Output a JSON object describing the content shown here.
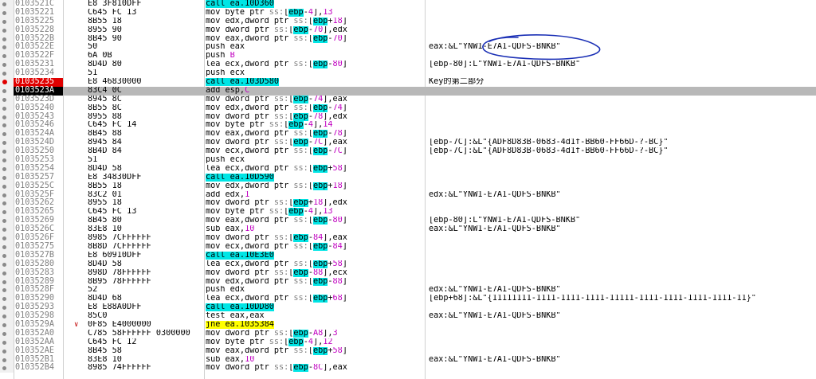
{
  "colors": {
    "breakpoint": "#e00000",
    "current": "#000000",
    "call_highlight": "#00e5e5",
    "jump_highlight": "#ffff00",
    "annotation_ink": "#1a2fb5"
  },
  "rows": [
    {
      "addr": "0103521C",
      "bytes": "E8 3F810DFF",
      "instr": "call ea.10D360",
      "kind": "call",
      "comment": ""
    },
    {
      "addr": "01035221",
      "bytes": "C645 FC 13",
      "instr": "mov byte ptr ss:[ebp-4],13",
      "comment": ""
    },
    {
      "addr": "01035225",
      "bytes": "8B55 18",
      "instr": "mov edx,dword ptr ss:[ebp+18]",
      "comment": ""
    },
    {
      "addr": "01035228",
      "bytes": "8955 90",
      "instr": "mov dword ptr ss:[ebp-70],edx",
      "comment": ""
    },
    {
      "addr": "0103522B",
      "bytes": "8B45 90",
      "instr": "mov eax,dword ptr ss:[ebp-70]",
      "comment": ""
    },
    {
      "addr": "0103522E",
      "bytes": "50",
      "instr": "push eax",
      "comment": "eax:&L\"YNW1-E7A1-QDFS-BNKB\""
    },
    {
      "addr": "0103522F",
      "bytes": "6A 0B",
      "instr": "push B",
      "comment": ""
    },
    {
      "addr": "01035231",
      "bytes": "8D4D 80",
      "instr": "lea ecx,dword ptr ss:[ebp-80]",
      "comment": "[ebp-80]:L\"YNW1-E7A1-QDFS-BNKB\""
    },
    {
      "addr": "01035234",
      "bytes": "51",
      "instr": "push ecx",
      "comment": ""
    },
    {
      "addr": "01035235",
      "bytes": "E8 46830000",
      "instr": "call ea.103D580",
      "kind": "call",
      "bp": true,
      "comment": "Key的第二部分"
    },
    {
      "addr": "0103523A",
      "bytes": "83C4 0C",
      "instr": "add esp,C",
      "cur": true,
      "comment": ""
    },
    {
      "addr": "0103523D",
      "bytes": "8945 8C",
      "instr": "mov dword ptr ss:[ebp-74],eax",
      "comment": ""
    },
    {
      "addr": "01035240",
      "bytes": "8B55 8C",
      "instr": "mov edx,dword ptr ss:[ebp-74]",
      "comment": ""
    },
    {
      "addr": "01035243",
      "bytes": "8955 88",
      "instr": "mov dword ptr ss:[ebp-78],edx",
      "comment": ""
    },
    {
      "addr": "01035246",
      "bytes": "C645 FC 14",
      "instr": "mov byte ptr ss:[ebp-4],14",
      "comment": ""
    },
    {
      "addr": "0103524A",
      "bytes": "8B45 88",
      "instr": "mov eax,dword ptr ss:[ebp-78]",
      "comment": ""
    },
    {
      "addr": "0103524D",
      "bytes": "8945 84",
      "instr": "mov dword ptr ss:[ebp-7C],eax",
      "comment": "[ebp-7C]:&L\"{ADF8D83B-0683-4d1f-BB60-FF66D-?-BC}\""
    },
    {
      "addr": "01035250",
      "bytes": "8B4D 84",
      "instr": "mov ecx,dword ptr ss:[ebp-7C]",
      "comment": "[ebp-7C]:&L\"{ADF8D83B-0683-4d1f-BB60-FF66D-?-BC}\""
    },
    {
      "addr": "01035253",
      "bytes": "51",
      "instr": "push ecx",
      "comment": ""
    },
    {
      "addr": "01035254",
      "bytes": "8D4D 58",
      "instr": "lea ecx,dword ptr ss:[ebp+58]",
      "comment": ""
    },
    {
      "addr": "01035257",
      "bytes": "E8 34830DFF",
      "instr": "call ea.10D590",
      "kind": "call",
      "comment": ""
    },
    {
      "addr": "0103525C",
      "bytes": "8B55 18",
      "instr": "mov edx,dword ptr ss:[ebp+18]",
      "comment": ""
    },
    {
      "addr": "0103525F",
      "bytes": "83C2 01",
      "instr": "add edx,1",
      "comment": "edx:&L\"YNW1-E7A1-QDFS-BNKB\""
    },
    {
      "addr": "01035262",
      "bytes": "8955 18",
      "instr": "mov dword ptr ss:[ebp+18],edx",
      "comment": ""
    },
    {
      "addr": "01035265",
      "bytes": "C645 FC 13",
      "instr": "mov byte ptr ss:[ebp-4],13",
      "comment": ""
    },
    {
      "addr": "01035269",
      "bytes": "8B45 80",
      "instr": "mov eax,dword ptr ss:[ebp-80]",
      "comment": "[ebp-80]:L\"YNW1-E7A1-QDFS-BNKB\""
    },
    {
      "addr": "0103526C",
      "bytes": "83E8 10",
      "instr": "sub eax,10",
      "comment": "eax:&L\"YNW1-E7A1-QDFS-BNKB\""
    },
    {
      "addr": "0103526F",
      "bytes": "8985 7CFFFFFF",
      "instr": "mov dword ptr ss:[ebp-84],eax",
      "comment": ""
    },
    {
      "addr": "01035275",
      "bytes": "8B8D 7CFFFFFF",
      "instr": "mov ecx,dword ptr ss:[ebp-84]",
      "comment": ""
    },
    {
      "addr": "0103527B",
      "bytes": "E8 60910DFF",
      "instr": "call ea.10E3E0",
      "kind": "call",
      "comment": ""
    },
    {
      "addr": "01035280",
      "bytes": "8D4D 58",
      "instr": "lea ecx,dword ptr ss:[ebp+58]",
      "comment": ""
    },
    {
      "addr": "01035283",
      "bytes": "898D 78FFFFFF",
      "instr": "mov dword ptr ss:[ebp-88],ecx",
      "comment": ""
    },
    {
      "addr": "01035289",
      "bytes": "8B95 78FFFFFF",
      "instr": "mov edx,dword ptr ss:[ebp-88]",
      "comment": ""
    },
    {
      "addr": "0103528F",
      "bytes": "52",
      "instr": "push edx",
      "comment": "edx:&L\"YNW1-E7A1-QDFS-BNKB\""
    },
    {
      "addr": "01035290",
      "bytes": "8D4D 68",
      "instr": "lea ecx,dword ptr ss:[ebp+68]",
      "comment": "[ebp+68]:&L\"{11111111-1111-1111-1111-11111-1111-1111-1111-1111-11}\""
    },
    {
      "addr": "01035293",
      "bytes": "E8 E88A0DFF",
      "instr": "call ea.10DD80",
      "kind": "call",
      "comment": ""
    },
    {
      "addr": "01035298",
      "bytes": "85C0",
      "instr": "test eax,eax",
      "comment": "eax:&L\"YNW1-E7A1-QDFS-BNKB\""
    },
    {
      "addr": "0103529A",
      "bytes": "0F85 E4000000",
      "instr": "jne ea.1035384",
      "kind": "jmp",
      "arrow": "∨",
      "comment": ""
    },
    {
      "addr": "010352A0",
      "bytes": "C785 58FFFFFF 0300000",
      "instr": "mov dword ptr ss:[ebp-A8],3",
      "comment": ""
    },
    {
      "addr": "010352AA",
      "bytes": "C645 FC 12",
      "instr": "mov byte ptr ss:[ebp-4],12",
      "comment": ""
    },
    {
      "addr": "010352AE",
      "bytes": "8B45 58",
      "instr": "mov eax,dword ptr ss:[ebp+58]",
      "comment": ""
    },
    {
      "addr": "010352B1",
      "bytes": "83E8 10",
      "instr": "sub eax,10",
      "comment": "eax:&L\"YNW1-E7A1-QDFS-BNKB\""
    },
    {
      "addr": "010352B4",
      "bytes": "8985 74FFFFFF",
      "instr": "mov dword ptr ss:[ebp-8C],eax",
      "comment": ""
    }
  ]
}
